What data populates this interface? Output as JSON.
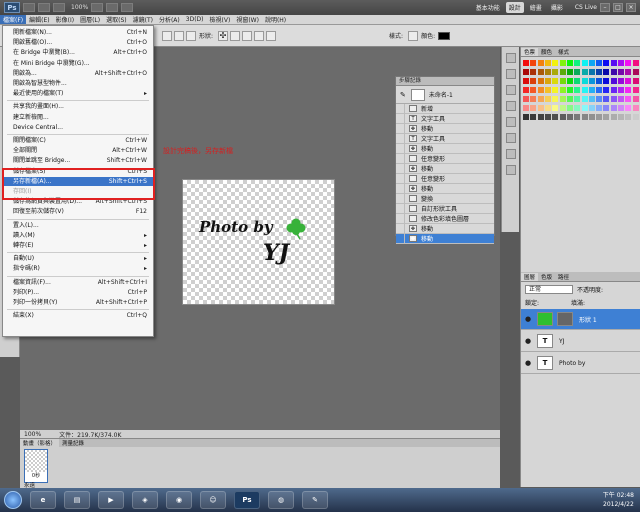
{
  "appbar": {
    "logo": "Ps",
    "zoom": "100%",
    "workspaces": [
      "基本功能",
      "設計",
      "繪畫",
      "攝影"
    ],
    "active_workspace": "設計",
    "cslive": "CS Live"
  },
  "menubar": [
    "檔案(F)",
    "編輯(E)",
    "影像(I)",
    "圖層(L)",
    "選取(S)",
    "濾鏡(T)",
    "分析(A)",
    "3D(D)",
    "檢視(V)",
    "視窗(W)",
    "說明(H)"
  ],
  "options": {
    "shape_label": "形狀:",
    "style_label": "樣式:",
    "color_label": "顏色:"
  },
  "file_menu": [
    {
      "label": "開新檔案(N)...",
      "shortcut": "Ctrl+N"
    },
    {
      "label": "開啟舊檔(O)...",
      "shortcut": "Ctrl+O"
    },
    {
      "label": "在 Bridge 中瀏覽(B)...",
      "shortcut": "Alt+Ctrl+O"
    },
    {
      "label": "在 Mini Bridge 中瀏覽(G)...",
      "shortcut": ""
    },
    {
      "label": "開啟為...",
      "shortcut": "Alt+Shift+Ctrl+O"
    },
    {
      "label": "開啟為智慧型物件...",
      "shortcut": ""
    },
    {
      "label": "最近使用的檔案(T)",
      "shortcut": "▸"
    },
    {
      "label": "共享我的畫面(H)...",
      "shortcut": ""
    },
    {
      "label": "建立新檢閱...",
      "shortcut": ""
    },
    {
      "label": "Device Central...",
      "shortcut": ""
    },
    {
      "label": "關閉檔案(C)",
      "shortcut": "Ctrl+W"
    },
    {
      "label": "全部關閉",
      "shortcut": "Alt+Ctrl+W"
    },
    {
      "label": "關閉並跳至 Bridge...",
      "shortcut": "Shift+Ctrl+W"
    },
    {
      "label": "儲存檔案(S)",
      "shortcut": "Ctrl+S"
    },
    {
      "label": "另存新檔(A)...",
      "shortcut": "Shift+Ctrl+S"
    },
    {
      "label": "存回(I)",
      "shortcut": ""
    },
    {
      "label": "儲存為網頁與裝置用(D)...",
      "shortcut": "Alt+Shift+Ctrl+S"
    },
    {
      "label": "回復至前次儲存(V)",
      "shortcut": "F12"
    },
    {
      "label": "置入(L)...",
      "shortcut": ""
    },
    {
      "label": "讀入(M)",
      "shortcut": "▸"
    },
    {
      "label": "轉存(E)",
      "shortcut": "▸"
    },
    {
      "label": "自動(U)",
      "shortcut": "▸"
    },
    {
      "label": "指令碼(R)",
      "shortcut": "▸"
    },
    {
      "label": "檔案資訊(F)...",
      "shortcut": "Alt+Shift+Ctrl+I"
    },
    {
      "label": "列印(P)...",
      "shortcut": "Ctrl+P"
    },
    {
      "label": "列印一份拷貝(Y)",
      "shortcut": "Alt+Shift+Ctrl+P"
    },
    {
      "label": "結束(X)",
      "shortcut": "Ctrl+Q"
    }
  ],
  "annotation": "設計完稿後，另存新檔",
  "document": {
    "line1": "Photo by",
    "line2": "YJ"
  },
  "status": {
    "zoom": "100%",
    "doc": "文件：219.7K/374.0K"
  },
  "history": {
    "tabs": "步驟記錄",
    "snapshot": "未命名-1",
    "items": [
      {
        "label": "新增",
        "icon": ""
      },
      {
        "label": "文字工具",
        "icon": "T"
      },
      {
        "label": "移動",
        "icon": "✥"
      },
      {
        "label": "文字工具",
        "icon": "T"
      },
      {
        "label": "移動",
        "icon": "✥"
      },
      {
        "label": "任意變形",
        "icon": ""
      },
      {
        "label": "移動",
        "icon": "✥"
      },
      {
        "label": "任意變形",
        "icon": ""
      },
      {
        "label": "移動",
        "icon": "✥"
      },
      {
        "label": "變換",
        "icon": ""
      },
      {
        "label": "自訂形狀工具",
        "icon": ""
      },
      {
        "label": "修改色彩填色圖層",
        "icon": ""
      },
      {
        "label": "移動",
        "icon": "✥"
      },
      {
        "label": "移動",
        "icon": "✥"
      }
    ]
  },
  "swatch_tabs": [
    "色票",
    "顏色",
    "樣式"
  ],
  "layers": {
    "tabs": [
      "圖層",
      "色版",
      "路徑"
    ],
    "blend": "正常",
    "opacity_label": "不透明度:",
    "lock_label": "鎖定:",
    "fill_label": "填滿:",
    "items": [
      {
        "name": "形狀 1",
        "thumb": ""
      },
      {
        "name": "YJ",
        "thumb": "T"
      },
      {
        "name": "Photo by",
        "thumb": "T"
      }
    ]
  },
  "film": {
    "tabs": [
      "動畫（影格）",
      "測量記錄"
    ],
    "frame": "0秒",
    "loop": "永遠"
  },
  "clock": {
    "time": "下午 02:48",
    "date": "2012/4/22"
  },
  "colors": {
    "accent": "#3e80d4",
    "highlight": "#e02020",
    "clover": "#38b23a"
  }
}
